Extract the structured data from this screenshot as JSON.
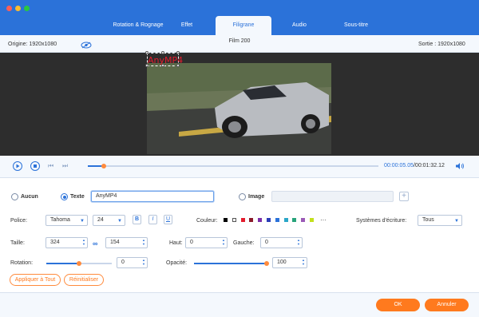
{
  "tabs": [
    {
      "label": "Rotation & Rognage"
    },
    {
      "label": "Effet"
    },
    {
      "label": "Filigrane"
    },
    {
      "label": "Audio"
    },
    {
      "label": "Sous-titre"
    }
  ],
  "info": {
    "origin": "Origine: 1920x1080",
    "title": "Film 200",
    "output": "Sortie : 1920x1080"
  },
  "watermark_preview_text": "AnyMP4",
  "player": {
    "current_time": "00:00:05.05",
    "total_time": "/00:01:32.12",
    "progress": 0.054
  },
  "watermark": {
    "none_label": "Aucun",
    "text_label": "Texte",
    "text_value": "AnyMP4",
    "image_label": "Image",
    "image_value": ""
  },
  "font": {
    "label": "Police:",
    "family": "Tahoma",
    "size": "24",
    "bold": "B",
    "italic": "I",
    "underline": "U",
    "color_label": "Couleur:",
    "colors": [
      "#000000",
      "#ffffff",
      "#e31c2d",
      "#8b1a2b",
      "#7b2ea8",
      "#2b3fb8",
      "#2b72d9",
      "#2aa6c8",
      "#27a37a",
      "#9b59b6",
      "#c3e01c"
    ],
    "more": "···",
    "writing_label": "Systèmes d'écriture:",
    "writing_value": "Tous"
  },
  "size": {
    "label": "Taille:",
    "width": "324",
    "height": "154",
    "top_label": "Haut:",
    "top_value": "0",
    "left_label": "Gauche:",
    "left_value": "0"
  },
  "rotation": {
    "label": "Rotation:",
    "value": "0",
    "level": 0.5
  },
  "opacity": {
    "label": "Opacité:",
    "value": "100",
    "level": 1.0
  },
  "actions": {
    "apply_all": "Appliquer à Tout",
    "reset": "Réinitialiser"
  },
  "footer": {
    "ok": "OK",
    "cancel": "Annuler"
  },
  "colors": {
    "primary": "#2b72d9",
    "accent": "#ff7a1e"
  }
}
